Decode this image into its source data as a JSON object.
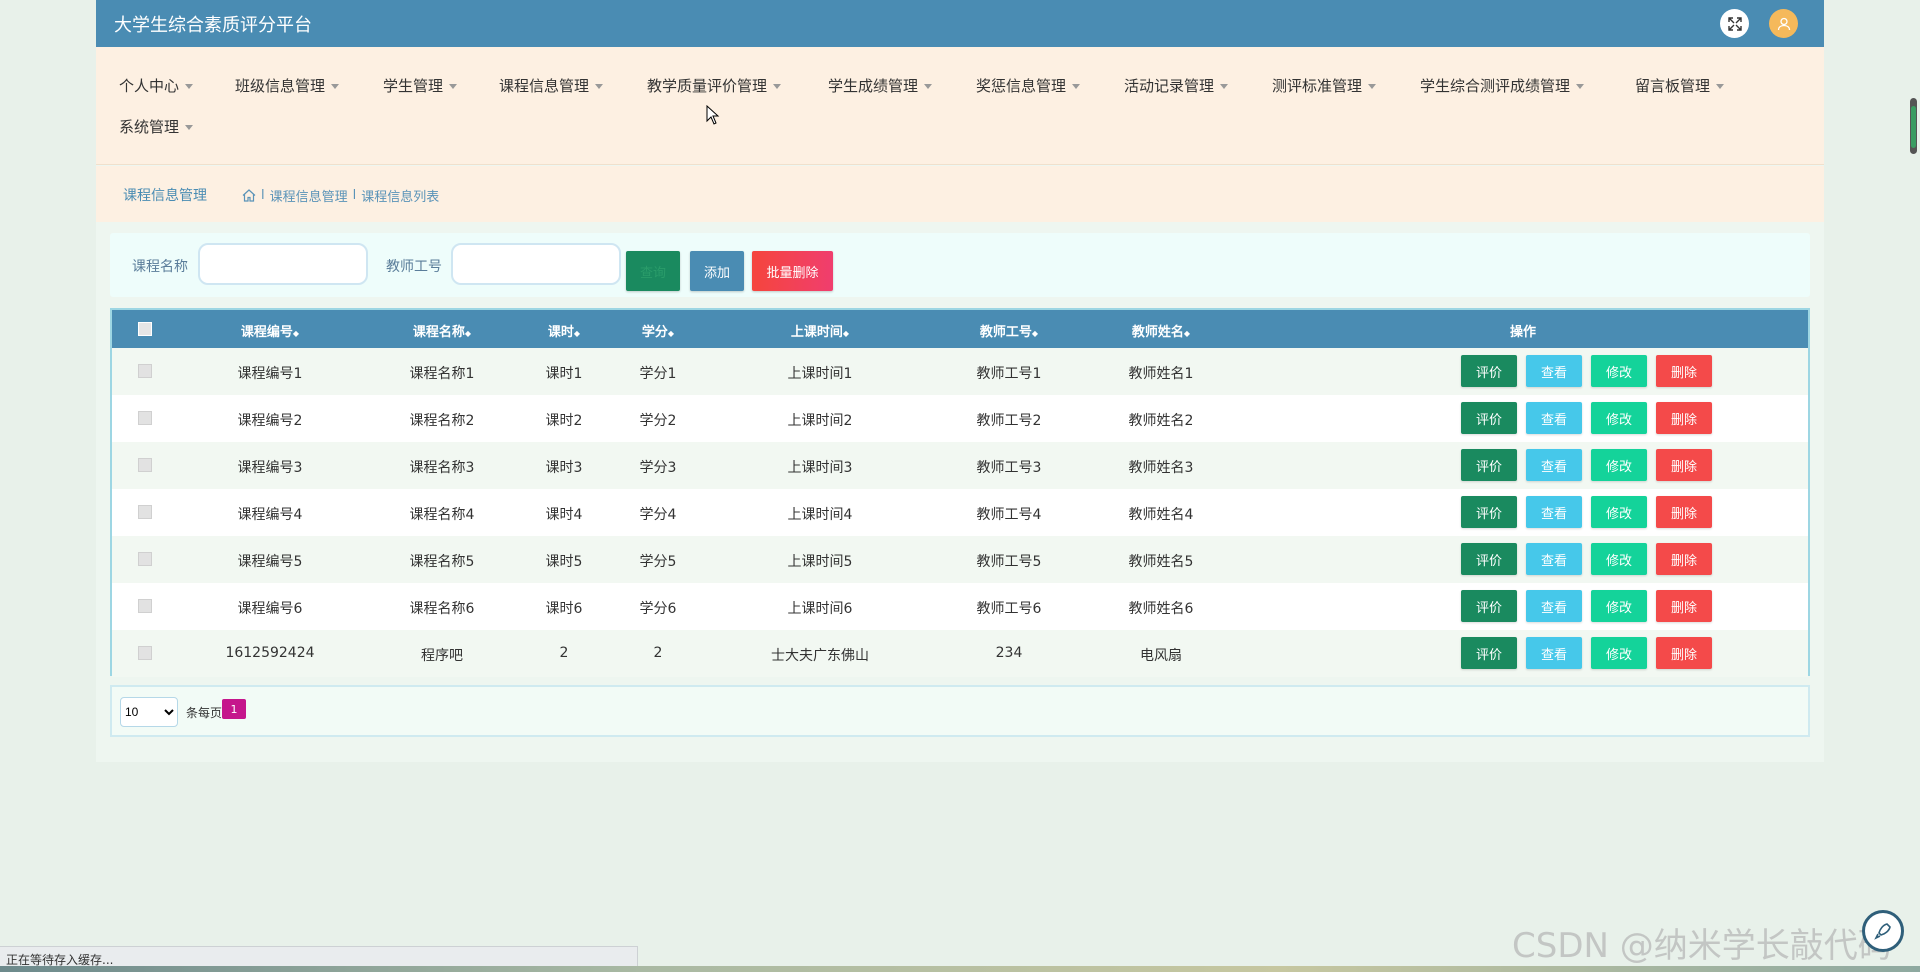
{
  "header": {
    "title": "大学生综合素质评分平台"
  },
  "nav": {
    "items": [
      {
        "label": "个人中心"
      },
      {
        "label": "班级信息管理"
      },
      {
        "label": "学生管理"
      },
      {
        "label": "课程信息管理"
      },
      {
        "label": "教学质量评价管理"
      },
      {
        "label": "学生成绩管理"
      },
      {
        "label": "奖惩信息管理"
      },
      {
        "label": "活动记录管理"
      },
      {
        "label": "测评标准管理"
      },
      {
        "label": "学生综合测评成绩管理"
      },
      {
        "label": "留言板管理"
      },
      {
        "label": "系统管理"
      }
    ]
  },
  "breadcrumb": {
    "section": "课程信息管理",
    "path": [
      "课程信息管理",
      "课程信息列表"
    ],
    "separator": "l"
  },
  "search": {
    "course_name_label": "课程名称",
    "teacher_id_label": "教师工号",
    "search_button": "查询",
    "add_button": "添加",
    "batch_delete_button": "批量删除"
  },
  "table": {
    "headers": [
      "课程编号",
      "课程名称",
      "课时",
      "学分",
      "上课时间",
      "教师工号",
      "教师姓名",
      "操作"
    ],
    "sort_glyph": "◆",
    "rows": [
      [
        "课程编号1",
        "课程名称1",
        "课时1",
        "学分1",
        "上课时间1",
        "教师工号1",
        "教师姓名1"
      ],
      [
        "课程编号2",
        "课程名称2",
        "课时2",
        "学分2",
        "上课时间2",
        "教师工号2",
        "教师姓名2"
      ],
      [
        "课程编号3",
        "课程名称3",
        "课时3",
        "学分3",
        "上课时间3",
        "教师工号3",
        "教师姓名3"
      ],
      [
        "课程编号4",
        "课程名称4",
        "课时4",
        "学分4",
        "上课时间4",
        "教师工号4",
        "教师姓名4"
      ],
      [
        "课程编号5",
        "课程名称5",
        "课时5",
        "学分5",
        "上课时间5",
        "教师工号5",
        "教师姓名5"
      ],
      [
        "课程编号6",
        "课程名称6",
        "课时6",
        "学分6",
        "上课时间6",
        "教师工号6",
        "教师姓名6"
      ],
      [
        "1612592424",
        "程序吧",
        "2",
        "2",
        "士大夫广东佛山",
        "234",
        "电风扇"
      ]
    ],
    "actions": [
      "评价",
      "查看",
      "修改",
      "删除"
    ]
  },
  "pager": {
    "page_size": "10",
    "per_page_label": "条每页",
    "current_page": "1"
  },
  "status": {
    "text": "正在等待存入缓存..."
  },
  "watermark": "CSDN @纳米学长敲代码",
  "colors": {
    "header": "#4a8cb3",
    "nav_bg": "#fdf0e2",
    "evaluate": "#1a8a5f",
    "view": "#46c8ea",
    "edit": "#14d39a",
    "delete": "#f44a4a",
    "page_active": "#c5168c"
  }
}
